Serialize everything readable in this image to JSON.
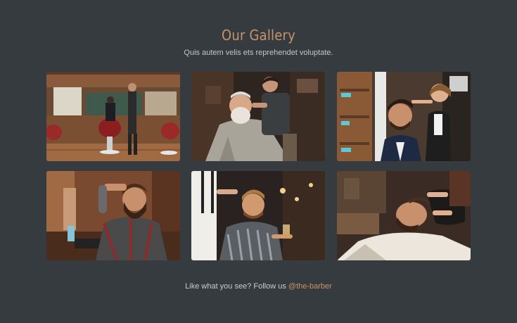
{
  "header": {
    "title": "Our Gallery",
    "subtitle": "Quis autem velis ets reprehendet voluptate."
  },
  "gallery": {
    "images": [
      {
        "name": "barbershop-interior-photo"
      },
      {
        "name": "elderly-man-beard-trim-photo"
      },
      {
        "name": "man-hair-styling-photo"
      },
      {
        "name": "bearded-man-in-plaid-shirt-photo"
      },
      {
        "name": "man-getting-haircut-photo"
      },
      {
        "name": "man-hair-wash-photo"
      }
    ]
  },
  "footer": {
    "text": "Like what you see? Follow us ",
    "handle": "@the-barber"
  },
  "colors": {
    "background": "#353b3e",
    "accent": "#c8936a",
    "text": "#c2c6c8"
  }
}
